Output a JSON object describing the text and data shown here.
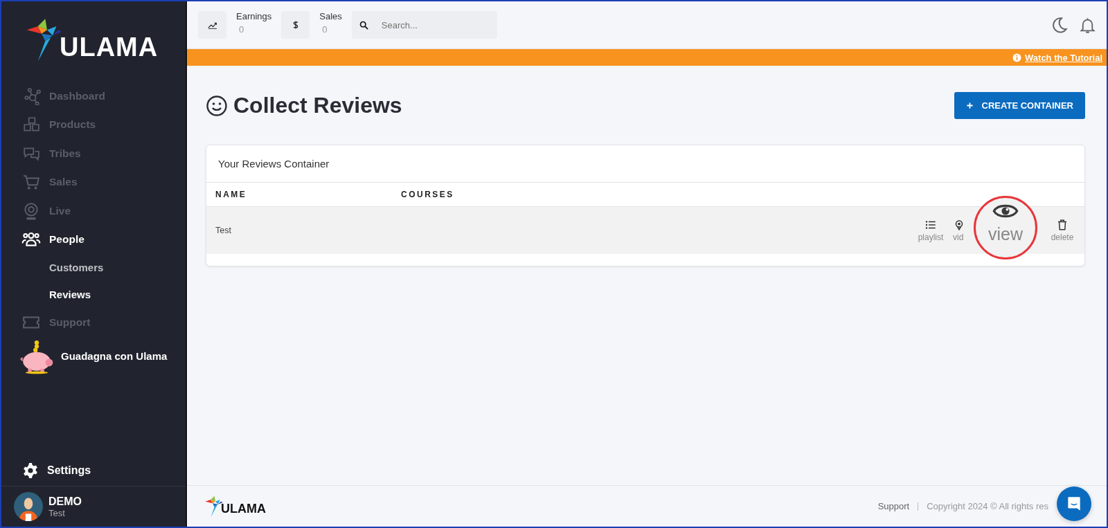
{
  "sidebar": {
    "logo": "ULAMA",
    "items": [
      {
        "label": "Dashboard",
        "active": false
      },
      {
        "label": "Products",
        "active": false
      },
      {
        "label": "Tribes",
        "active": false
      },
      {
        "label": "Sales",
        "active": false
      },
      {
        "label": "Live",
        "active": false
      },
      {
        "label": "People",
        "active": true,
        "expanded": true,
        "children": [
          {
            "label": "Customers",
            "selected": false
          },
          {
            "label": "Reviews",
            "selected": true
          }
        ]
      },
      {
        "label": "Support",
        "active": false
      },
      {
        "label": "Guadagna con Ulama",
        "active": true,
        "kind": "promo"
      }
    ],
    "settings": "Settings",
    "user": {
      "name": "DEMO",
      "role": "Test"
    }
  },
  "topbar": {
    "stats": [
      {
        "label": "Earnings",
        "value": "0"
      },
      {
        "label": "Sales",
        "value": "0"
      }
    ],
    "search": {
      "placeholder": "Search..."
    }
  },
  "banner": {
    "link": "Watch the Tutorial"
  },
  "page": {
    "title": "Collect Reviews",
    "create_button": "CREATE CONTAINER"
  },
  "card": {
    "title": "Your Reviews Container",
    "columns": [
      "NAME",
      "COURSES"
    ],
    "rows": [
      {
        "name": "Test",
        "actions": [
          {
            "kind": "playlist",
            "label": "playlist"
          },
          {
            "kind": "video",
            "label": "vid"
          },
          {
            "kind": "delete",
            "label": "delete"
          }
        ]
      }
    ],
    "callout": {
      "label": "view"
    }
  },
  "footer": {
    "logo": "ULAMA",
    "links": [
      "Support"
    ],
    "copyright": "Copyright 2024 © All rights res"
  }
}
